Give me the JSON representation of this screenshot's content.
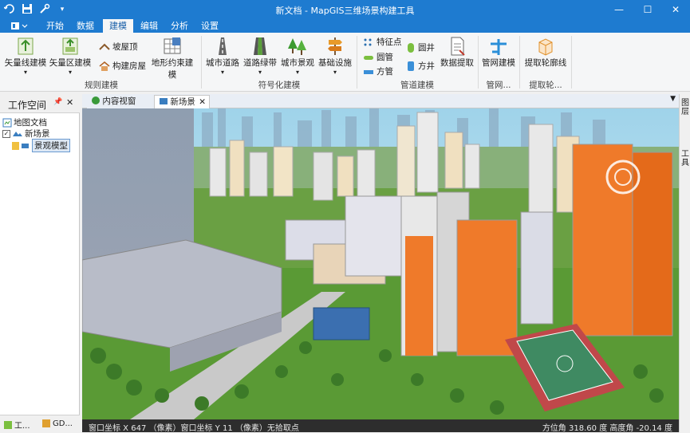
{
  "app": {
    "title": "新文档 - MapGIS三维场景构建工具"
  },
  "ribbon_tabs": [
    {
      "label": "开始"
    },
    {
      "label": "数据"
    },
    {
      "label": "建模"
    },
    {
      "label": "编辑"
    },
    {
      "label": "分析"
    },
    {
      "label": "设置"
    }
  ],
  "active_tab": "建模",
  "ribbon": {
    "rule_group": {
      "label": "规则建模",
      "vector_line": "矢量线建模",
      "vector_area": "矢量区建模",
      "slope_roof": "坡屋顶",
      "build_house": "构建房屋",
      "terrain_constraint": "地形约束建模"
    },
    "symbol_group": {
      "label": "符号化建模",
      "city_road": "城市道路",
      "road_green": "道路绿带",
      "city_landscape": "城市景观",
      "infrastructure": "基础设施"
    },
    "pipe_group": {
      "label": "管道建模",
      "feature_point": "特征点",
      "round_pipe": "圆管",
      "square_pipe": "方管",
      "round_well": "圆井",
      "square_well": "方井",
      "data_extract": "数据提取"
    },
    "network_group": {
      "label": "管网...",
      "network_model": "管网建模"
    },
    "outline_group": {
      "label": "提取轮...",
      "extract_outline": "提取轮廓线"
    }
  },
  "workspace": {
    "title": "工作空间",
    "tree": [
      {
        "label": "地图文档"
      },
      {
        "label": "新场景"
      },
      {
        "label": "景观模型"
      }
    ],
    "bottom_tabs": [
      {
        "label": "工..."
      },
      {
        "label": "GD..."
      }
    ]
  },
  "doc_tabs": [
    {
      "label": "内容视窗"
    },
    {
      "label": "新场景"
    }
  ],
  "status": {
    "window_x_label": "窗口坐标 X",
    "window_x": "647",
    "pixel_unit_1": "（像素）",
    "window_y_label": "窗口坐标 Y",
    "window_y": "11",
    "pixel_unit_2": "（像素）",
    "pick_status": "无拾取点",
    "azimuth_label": "方位角",
    "azimuth": "318.60",
    "deg1": "度",
    "pitch_label": "高度角",
    "pitch": "-20.14",
    "deg2": "度"
  },
  "right_strip": {
    "tab1": "图层",
    "tab2": "工具"
  },
  "colors": {
    "title_blue": "#1e7bd0",
    "ribbon_bg": "#f5f6f7",
    "status_bg": "#2d2d2d"
  }
}
